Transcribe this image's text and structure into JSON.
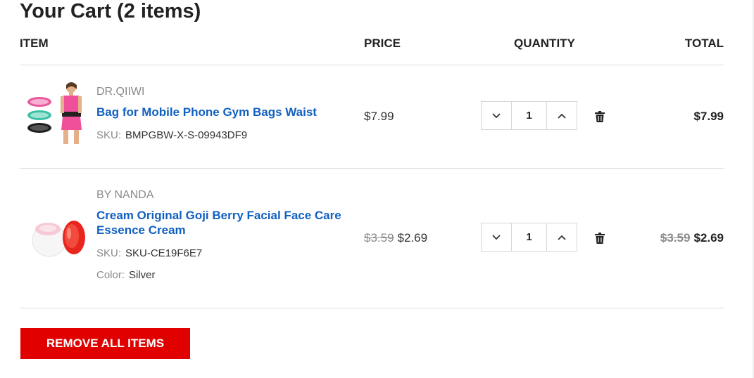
{
  "cart": {
    "title": "Your Cart (2 items)",
    "columns": {
      "item": "ITEM",
      "price": "PRICE",
      "quantity": "QUANTITY",
      "total": "TOTAL"
    },
    "items": [
      {
        "brand": "DR.QIIWI",
        "name": "Bag for Mobile Phone Gym Bags Waist",
        "sku_label": "SKU:",
        "sku": "BMPGBW-X-S-09943DF9",
        "price": "$7.99",
        "quantity": "1",
        "total": "$7.99",
        "image_icon": "waist-bag-product-image"
      },
      {
        "brand": "BY NANDA",
        "name": "Cream Original Goji Berry Facial Face Care Essence Cream",
        "sku_label": "SKU:",
        "sku": "SKU-CE19F6E7",
        "color_label": "Color:",
        "color": "Silver",
        "original_price": "$3.59",
        "price": "$2.69",
        "quantity": "1",
        "original_total": "$3.59",
        "total": "$2.69",
        "image_icon": "cream-jar-product-image"
      }
    ],
    "remove_all_label": "REMOVE ALL ITEMS",
    "colors": {
      "link": "#1160c0",
      "accent": "#e00000",
      "muted": "#8a8a8a"
    }
  }
}
